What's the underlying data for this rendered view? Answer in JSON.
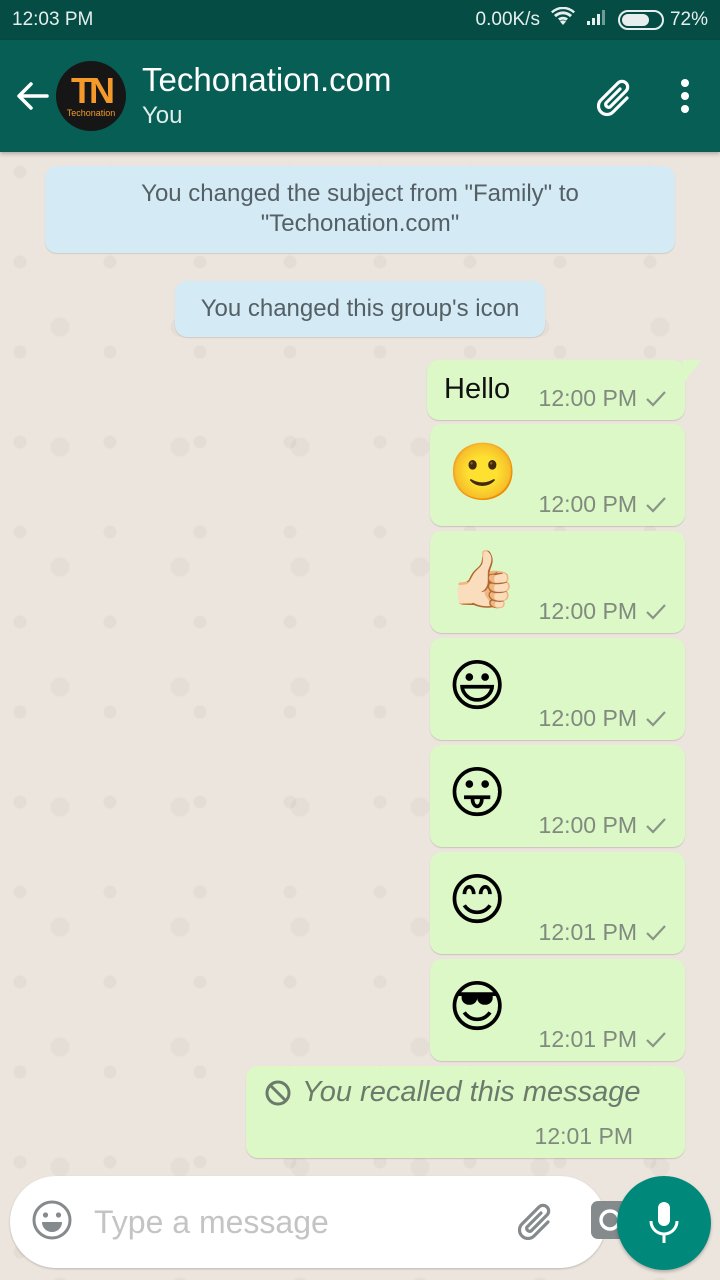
{
  "status_bar": {
    "time": "12:03 PM",
    "network_speed": "0.00K/s",
    "battery_percent": "72%",
    "battery_level": 0.72,
    "icons": [
      "wifi-icon",
      "signal-icon",
      "battery-icon"
    ]
  },
  "header": {
    "title": "Techonation.com",
    "subtitle": "You",
    "avatar_letters": "TN",
    "avatar_brand": "Techonation",
    "icons": [
      "back-arrow-icon",
      "paperclip-icon",
      "more-vert-icon"
    ]
  },
  "colors": {
    "status_bar": "#054c44",
    "app_bar": "#075e54",
    "outgoing_bubble": "#dcf8c6",
    "system_bubble": "#d4eaf4",
    "fab": "#00897b",
    "avatar_accent": "#f39a2a"
  },
  "system_messages": [
    {
      "text_line1": "You changed the subject from \"Family\" to",
      "text_line2": "\"Techonation.com\""
    },
    {
      "text": "You changed this group's icon"
    }
  ],
  "messages": [
    {
      "type": "text",
      "text": "Hello",
      "time": "12:00 PM",
      "status": "sent"
    },
    {
      "type": "emoji",
      "emoji": "🙂",
      "name": "slightly-smiling-face",
      "time": "12:00 PM",
      "status": "sent"
    },
    {
      "type": "emoji",
      "emoji": "👍🏻",
      "name": "thumbs-up-light-skin",
      "time": "12:00 PM",
      "status": "sent"
    },
    {
      "type": "emoji",
      "emoji": "😃",
      "name": "grinning-face-big-eyes",
      "time": "12:00 PM",
      "status": "sent"
    },
    {
      "type": "emoji",
      "emoji": "😛",
      "name": "face-with-tongue",
      "time": "12:00 PM",
      "status": "sent"
    },
    {
      "type": "emoji",
      "emoji": "😊",
      "name": "smiling-face-smiling-eyes",
      "time": "12:01 PM",
      "status": "sent"
    },
    {
      "type": "emoji",
      "emoji": "😎",
      "name": "smiling-face-sunglasses",
      "time": "12:01 PM",
      "status": "sent"
    },
    {
      "type": "recalled",
      "text": "You recalled this message",
      "time": "12:01 PM"
    }
  ],
  "input": {
    "placeholder": "Type a message",
    "value": ""
  }
}
